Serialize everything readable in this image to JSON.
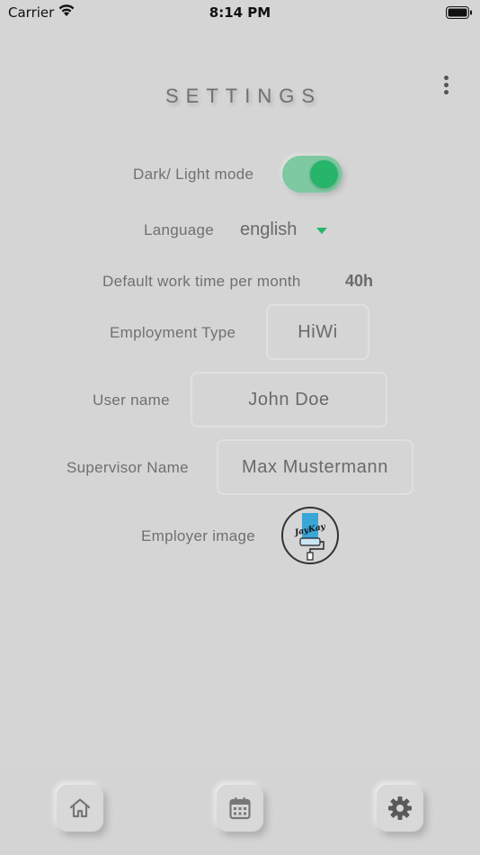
{
  "status_bar": {
    "carrier": "Carrier",
    "time": "8:14 PM",
    "icons": [
      "wifi-icon",
      "battery-icon"
    ]
  },
  "header": {
    "title": "SETTINGS",
    "menu_icon": "more-vertical-icon"
  },
  "settings": {
    "dark_mode": {
      "label": "Dark/ Light mode",
      "enabled": true,
      "accent": "#27b56a"
    },
    "language": {
      "label": "Language",
      "value": "english",
      "caret_icon": "dropdown-caret-icon"
    },
    "work_time": {
      "label": "Default work time per month",
      "value": "40h"
    },
    "employment_type": {
      "label": "Employment Type",
      "value": "HiWi"
    },
    "user_name": {
      "label": "User name",
      "value": "John Doe"
    },
    "supervisor_name": {
      "label": "Supervisor Name",
      "value": "Max Mustermann"
    },
    "employer_image": {
      "label": "Employer image",
      "logo_text": "JayKay"
    }
  },
  "nav": {
    "items": [
      {
        "name": "home",
        "icon": "home-icon"
      },
      {
        "name": "calendar",
        "icon": "calendar-icon"
      },
      {
        "name": "settings",
        "icon": "gear-icon"
      }
    ]
  },
  "colors": {
    "background": "#d5d5d5",
    "text": "#707070",
    "accent": "#27b56a"
  }
}
